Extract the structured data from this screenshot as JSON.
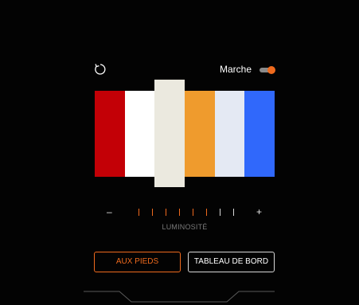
{
  "header": {
    "reset_icon": "reset-icon",
    "power_label": "Marche",
    "power_on": true
  },
  "colors": {
    "accent": "#ef6a1d",
    "swatches": [
      "#c30006",
      "#ffffff",
      "#ebe9df",
      "#ef9b2d",
      "#e4e9f3",
      "#3068fb"
    ],
    "selected_index": 2
  },
  "brightness": {
    "minus_label": "–",
    "plus_label": "+",
    "label": "LUMINOSITÉ",
    "ticks_total": 8,
    "ticks_active": 6
  },
  "zones": {
    "feet_label": "AUX PIEDS",
    "dashboard_label": "TABLEAU DE BORD",
    "active": "feet"
  }
}
